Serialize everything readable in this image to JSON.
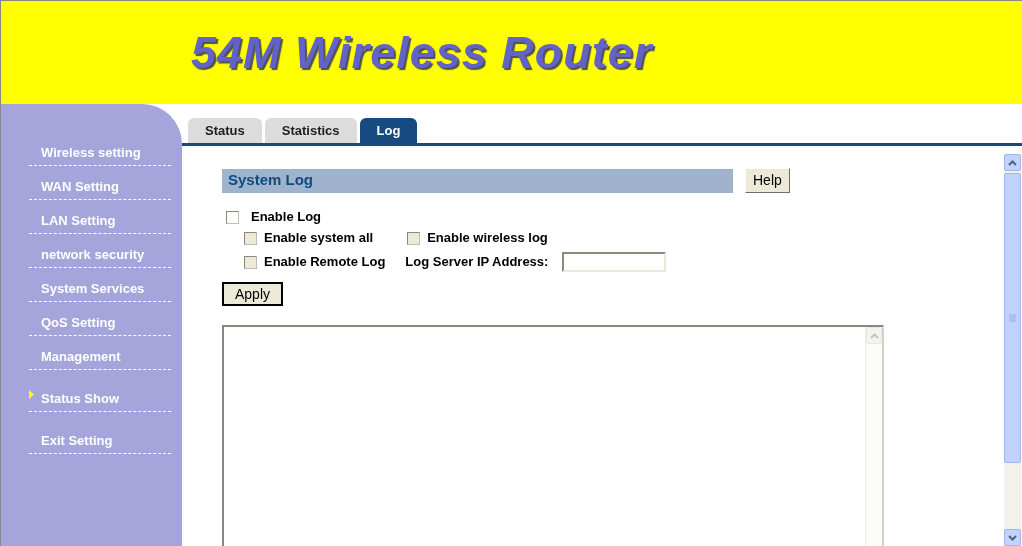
{
  "header": {
    "title": "54M Wireless Router"
  },
  "sidebar": {
    "groups": [
      {
        "items": [
          {
            "label": "Wireless setting",
            "selected": false
          },
          {
            "label": "WAN Setting",
            "selected": false
          },
          {
            "label": "LAN Setting",
            "selected": false
          },
          {
            "label": "network security",
            "selected": false
          },
          {
            "label": "System Services",
            "selected": false
          },
          {
            "label": "QoS Setting",
            "selected": false
          },
          {
            "label": "Management",
            "selected": false
          }
        ]
      },
      {
        "items": [
          {
            "label": "Status Show",
            "selected": true
          }
        ]
      },
      {
        "items": [
          {
            "label": "Exit Setting",
            "selected": false
          }
        ]
      }
    ]
  },
  "tabs": [
    {
      "label": "Status",
      "selected": false
    },
    {
      "label": "Statistics",
      "selected": false
    },
    {
      "label": "Log",
      "selected": true
    }
  ],
  "section": {
    "title": "System Log",
    "help_button": "Help"
  },
  "enable_log": {
    "label": "Enable Log",
    "checked": false,
    "disabled": false
  },
  "options": [
    {
      "label": "Enable system all",
      "checked": false,
      "disabled": true
    },
    {
      "label": "Enable wireless log",
      "checked": false,
      "disabled": true
    }
  ],
  "remote": {
    "label": "Enable Remote Log",
    "checked": false,
    "disabled": true
  },
  "log_server": {
    "label": "Log Server IP Address:",
    "disabled": true
  },
  "apply_button": "Apply"
}
